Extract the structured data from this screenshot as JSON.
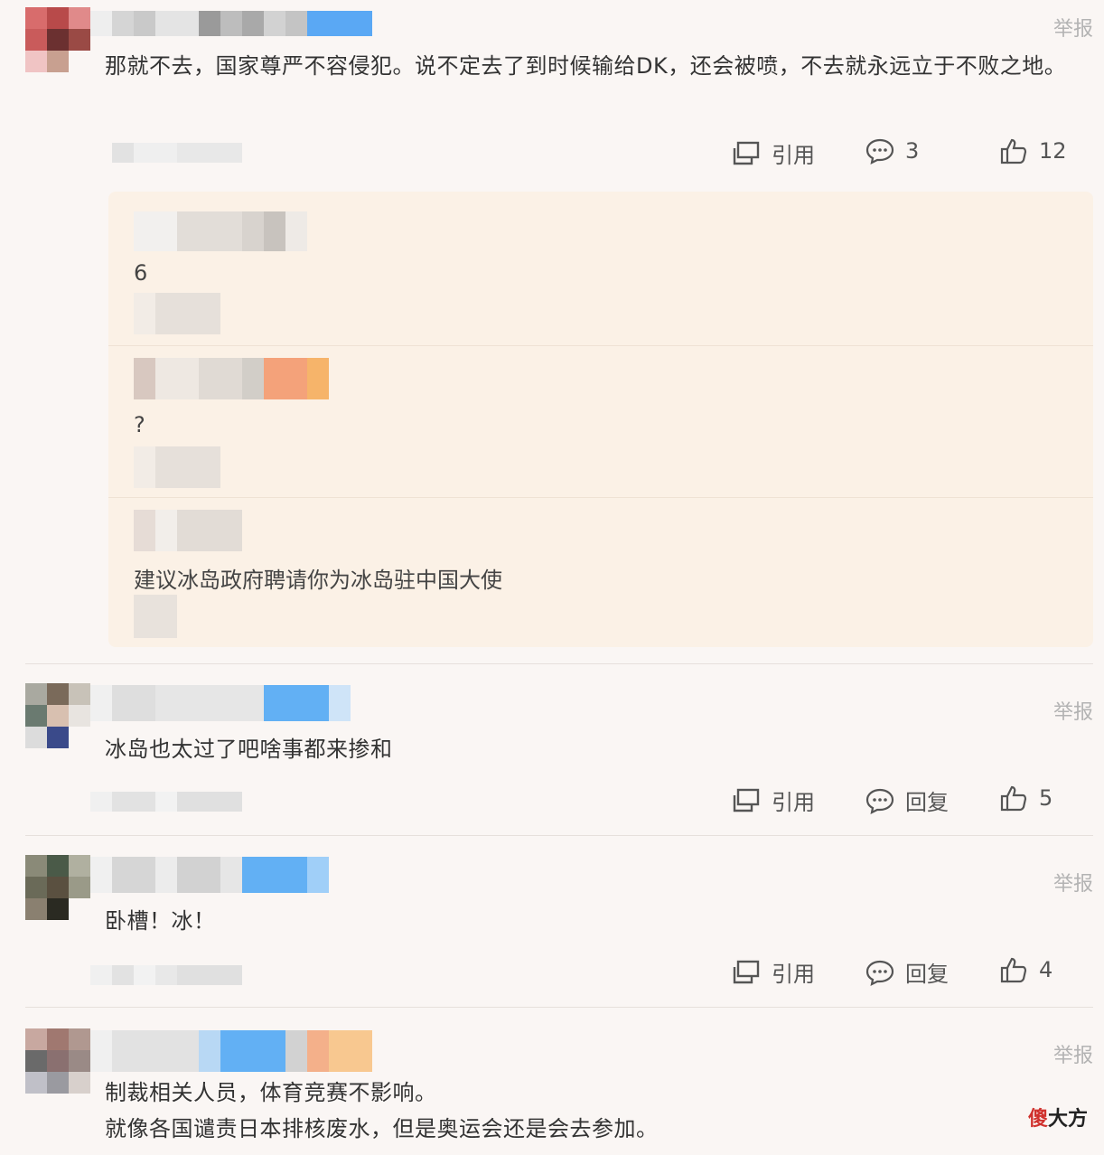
{
  "comments": [
    {
      "report_label": "举报",
      "content": "那就不去，国家尊严不容侵犯。说不定去了到时候输给DK，还会被喷，不去就永远立于不败之地。",
      "actions": {
        "quote": "引用",
        "reply": "3",
        "likes": "12"
      },
      "replies": [
        {
          "text": "6"
        },
        {
          "text": "?"
        },
        {
          "text": "建议冰岛政府聘请你为冰岛驻中国大使"
        }
      ]
    },
    {
      "report_label": "举报",
      "content": "冰岛也太过了吧啥事都来掺和",
      "actions": {
        "quote": "引用",
        "reply": "回复",
        "likes": "5"
      }
    },
    {
      "report_label": "举报",
      "content": "卧槽！冰！",
      "actions": {
        "quote": "引用",
        "reply": "回复",
        "likes": "4"
      }
    },
    {
      "report_label": "举报",
      "content_line1": "制裁相关人员，体育竞赛不影响。",
      "content_line2": "就像各国谴责日本排核废水，但是奥运会还是会去参加。"
    }
  ],
  "watermark": {
    "red": "傻",
    "rest": "大方"
  },
  "colors": {
    "background": "#faf6f4",
    "reply_panel": "#fbf1e6",
    "text": "#333333",
    "muted": "#b3b3b3"
  },
  "icons": [
    "quote-icon",
    "comment-bubble-icon",
    "thumbs-up-icon"
  ]
}
